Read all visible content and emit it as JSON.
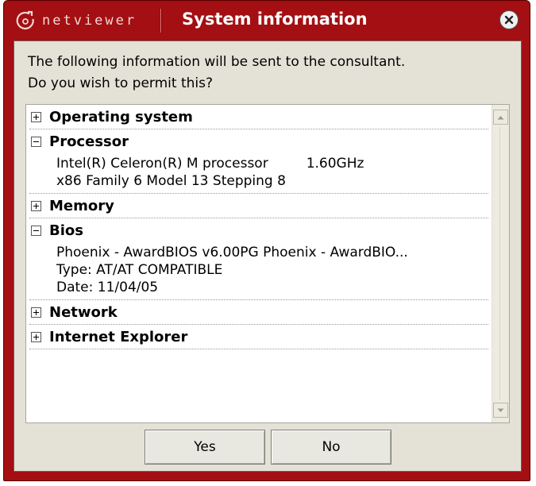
{
  "window": {
    "logo_text": "netviewer",
    "title": "System information"
  },
  "intro": {
    "line1": "The following information will be sent to the consultant.",
    "line2": "Do you wish to permit this?"
  },
  "sections": {
    "operating_system": {
      "label": "Operating system",
      "state": "collapsed"
    },
    "processor": {
      "label": "Processor",
      "state": "expanded",
      "name": "Intel(R) Celeron(R) M processor",
      "speed": "1.60GHz",
      "family": "x86 Family 6 Model 13 Stepping 8"
    },
    "memory": {
      "label": "Memory",
      "state": "collapsed"
    },
    "bios": {
      "label": "Bios",
      "state": "expanded",
      "vendor": "Phoenix - AwardBIOS v6.00PG Phoenix - AwardBIO...",
      "type": "Type:  AT/AT COMPATIBLE",
      "date": "Date:  11/04/05"
    },
    "network": {
      "label": "Network",
      "state": "collapsed"
    },
    "internet_explorer": {
      "label": "Internet Explorer",
      "state": "collapsed"
    }
  },
  "buttons": {
    "yes": "Yes",
    "no": "No"
  },
  "colors": {
    "titlebar": "#a30f12",
    "panel": "#e4e2d7"
  },
  "icons": [
    "netviewer-logo-icon",
    "close-icon",
    "expand-icon",
    "collapse-icon",
    "scroll-up-icon",
    "scroll-down-icon"
  ]
}
